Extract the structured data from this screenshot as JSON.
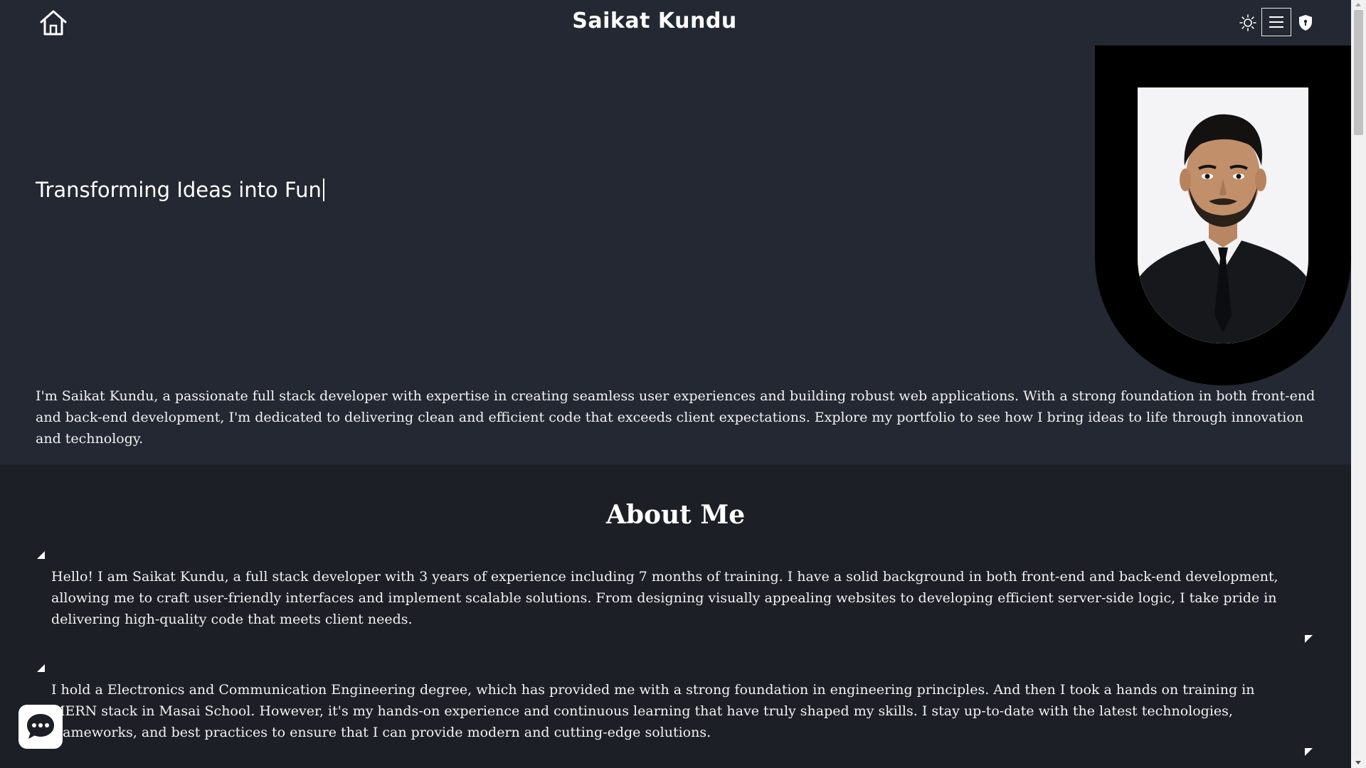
{
  "header": {
    "title": "Saikat Kundu",
    "icons": [
      "home-icon",
      "sun-icon",
      "hamburger-menu-icon",
      "shield-icon"
    ]
  },
  "hero": {
    "tagline": "Transforming Ideas into Fun",
    "intro": "I'm Saikat Kundu, a passionate full stack developer with expertise in creating seamless user experiences and building robust web applications. With a strong foundation in both front-end and back-end development, I'm dedicated to delivering clean and efficient code that exceeds client expectations. Explore my portfolio to see how I bring ideas to life through innovation and technology."
  },
  "about": {
    "title": "About Me",
    "paragraphs": [
      "Hello! I am Saikat Kundu, a full stack developer with 3 years of experience including 7 months of training. I have a solid background in both front-end and back-end development, allowing me to craft user-friendly interfaces and implement scalable solutions. From designing visually appealing websites to developing efficient server-side logic, I take pride in delivering high-quality code that meets client needs.",
      "I hold a Electronics and Communication Engineering degree, which has provided me with a strong foundation in engineering principles. And then I took a hands on training in MERN stack in Masai School. However, it's my hands-on experience and continuous learning that have truly shaped my skills. I stay up-to-date with the latest technologies, frameworks, and best practices to ensure that I can provide modern and cutting-edge solutions."
    ]
  },
  "colors": {
    "header_bg": "#232832",
    "hero_bg": "#232832",
    "about_bg": "#1c1f26",
    "photo_frame": "#000000",
    "text": "#ffffff"
  },
  "chat": {
    "icon": "chat-bubble-icon"
  }
}
